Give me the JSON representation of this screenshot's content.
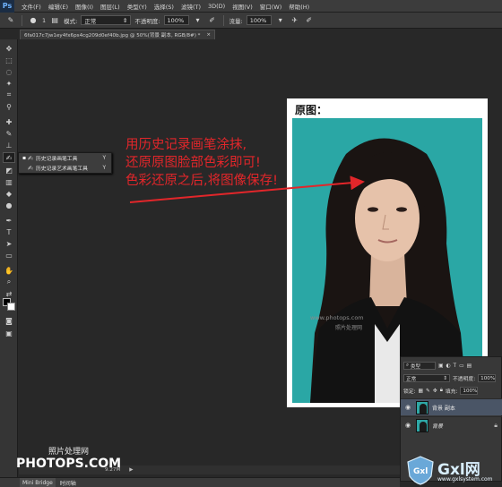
{
  "menubar": {
    "logo": "Ps",
    "items": [
      "文件(F)",
      "编辑(E)",
      "图像(I)",
      "图层(L)",
      "类型(Y)",
      "选择(S)",
      "滤镜(T)",
      "3D(D)",
      "视图(V)",
      "窗口(W)",
      "帮助(H)"
    ]
  },
  "options": {
    "brush_size": "1",
    "mode_label": "模式:",
    "mode_value": "正常",
    "opacity_label": "不透明度:",
    "opacity_value": "100%",
    "flow_label": "流量:",
    "flow_value": "100%"
  },
  "document": {
    "tab_title": "6fa017c7jw1ey4fx6ps4cg209d0ef40b.jpg @ 50%(背景 副本, RGB/8#) *",
    "close": "×"
  },
  "flyout": {
    "items": [
      {
        "label": "历史记录画笔工具",
        "key": "Y",
        "selected": true
      },
      {
        "label": "历史记录艺术画笔工具",
        "key": "Y",
        "selected": false
      }
    ]
  },
  "annotation": {
    "lines": [
      "用历史记录画笔涂抹,",
      "还原原图脸部色彩即可!",
      "色彩还原之后,将图像保存!"
    ],
    "color": "#e2262a"
  },
  "photo": {
    "title": "原图：",
    "background_color": "#2aa7a5",
    "watermark": "www.photops.com",
    "watermark2": "照片处理网"
  },
  "layers": {
    "kind_label": "类型",
    "blend_mode": "正常",
    "opacity_label": "不透明度:",
    "opacity_value": "100%",
    "lock_label": "锁定:",
    "fill_label": "填充:",
    "fill_value": "100%",
    "items": [
      {
        "name": "背景 副本",
        "selected": true
      },
      {
        "name": "背景",
        "selected": false
      }
    ]
  },
  "status": {
    "size": "9.27M"
  },
  "bottom_tabs": [
    "Mini Bridge",
    "时间轴"
  ],
  "watermarks": {
    "cn": "照片处理网",
    "big": "PHOTOPS.COM",
    "gxl": "Gxl网",
    "gxl_url": "www.gxlsystem.com"
  }
}
